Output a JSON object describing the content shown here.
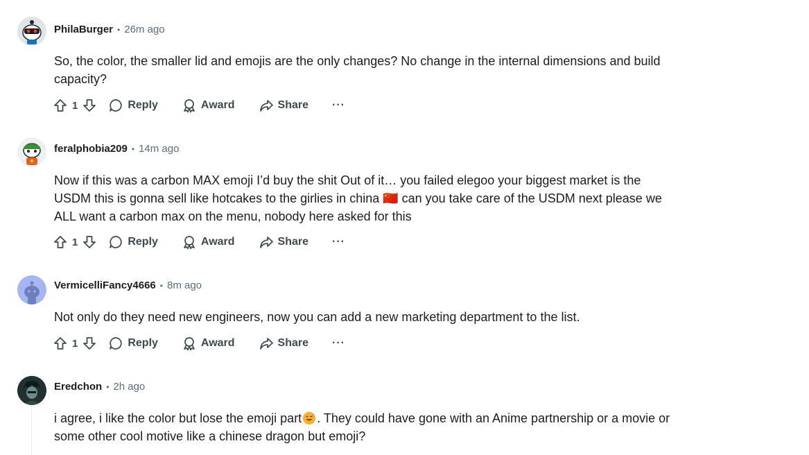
{
  "comments": [
    {
      "user": "PhilaBurger",
      "time": "26m ago",
      "text": "So, the color, the smaller lid and emojis are the only changes? No change in the internal dimensions and build capacity?",
      "votes": "1",
      "reply": "Reply",
      "award": "Award",
      "share": "Share",
      "more": "···"
    },
    {
      "user": "feralphobia209",
      "time": "14m ago",
      "text": "Now if this was a carbon MAX emoji I’d buy the shit Out of it… you failed elegoo your biggest market is the USDM this is gonna sell like hotcakes to the girlies in china 🇨🇳 can you take care of the USDM next please we ALL want a carbon max on the menu, nobody here asked for this",
      "votes": "1",
      "reply": "Reply",
      "award": "Award",
      "share": "Share",
      "more": "···"
    },
    {
      "user": "VermicelliFancy4666",
      "time": "8m ago",
      "text": "Not only do they need new engineers, now you can add a new marketing department to the list.",
      "votes": "1",
      "reply": "Reply",
      "award": "Award",
      "share": "Share",
      "more": "···"
    },
    {
      "user": "Eredchon",
      "time": "2h ago",
      "text_before": "i agree, i like the color but lose the emoji part",
      "text_after": ". They could have gone with an Anime partnership or a movie or some other cool motive like a chinese dragon but emoji?"
    }
  ],
  "separator": "•"
}
